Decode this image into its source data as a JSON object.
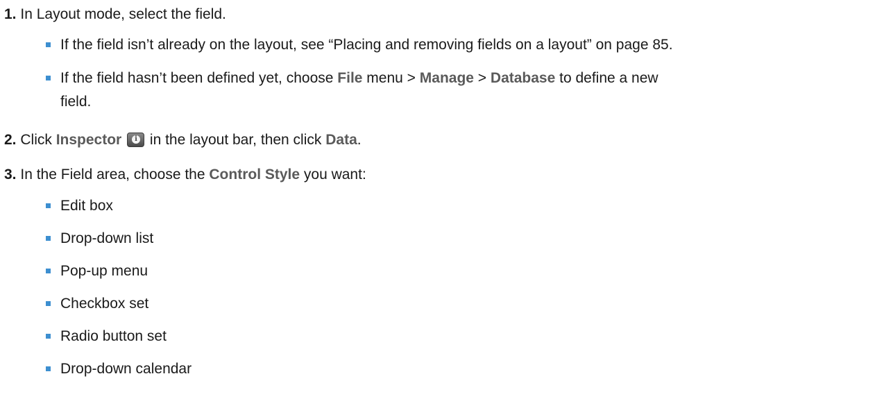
{
  "steps": [
    {
      "num": "1.",
      "text": "In Layout mode, select the field.",
      "bullets": [
        {
          "before": "If the field isn’t already on the layout, see “Placing and removing fields on a layout” on page 85."
        },
        {
          "before": "If the field hasn’t been defined yet, choose ",
          "file": "File",
          "mid1": " menu > ",
          "manage": "Manage",
          "mid2": " > ",
          "database": "Database",
          "after_line1": " to define a new",
          "line2": "field."
        }
      ]
    },
    {
      "num": "2.",
      "before": "Click ",
      "inspector": "Inspector",
      "middle": " in the layout bar, then click ",
      "data_label": "Data",
      "after": "."
    },
    {
      "num": "3.",
      "before": "In the Field area, choose the ",
      "control_style": "Control Style",
      "after": " you want:",
      "options": [
        "Edit box",
        "Drop-down list",
        "Pop-up menu",
        "Checkbox set",
        "Radio button set",
        "Drop-down calendar"
      ]
    }
  ],
  "icons": {
    "inspector_icon": "info-icon",
    "bullet_color": "#3d8fd0"
  }
}
